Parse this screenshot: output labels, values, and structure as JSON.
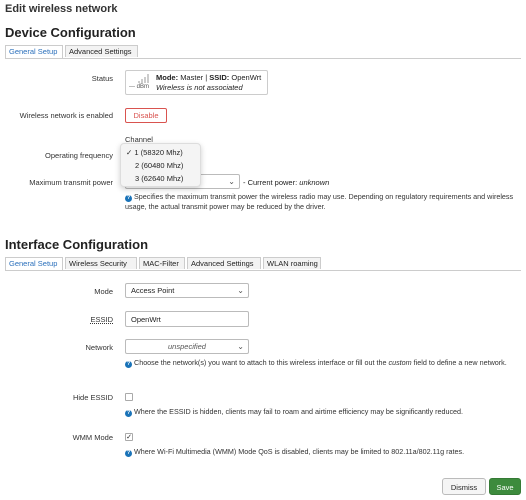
{
  "page_title": "Edit wireless network",
  "device": {
    "heading": "Device Configuration",
    "tabs": [
      "General Setup",
      "Advanced Settings"
    ],
    "status_label": "Status",
    "status": {
      "mode_prefix": "Mode:",
      "mode_value": "Master",
      "separator": "|",
      "ssid_prefix": "SSID:",
      "ssid_value": "OpenWrt",
      "signal": "--- dBm",
      "note": "Wireless is not associated"
    },
    "enabled_label": "Wireless network is enabled",
    "disable_button": "Disable",
    "channel_label": "Channel",
    "frequency_label": "Operating frequency",
    "frequency_options": [
      {
        "check": "✓",
        "label": "1 (58320 Mhz)"
      },
      {
        "check": "",
        "label": "2 (60480 Mhz)"
      },
      {
        "check": "",
        "label": "3 (62640 Mhz)"
      }
    ],
    "tx_label": "Maximum transmit power",
    "tx_current_prefix": "- Current power:",
    "tx_current_value": "unknown",
    "tx_help": "Specifies the maximum transmit power the wireless radio may use. Depending on regulatory requirements and wireless usage, the actual transmit power may be reduced by the driver."
  },
  "interface": {
    "heading": "Interface Configuration",
    "tabs": [
      "General Setup",
      "Wireless Security",
      "MAC-Filter",
      "Advanced Settings",
      "WLAN roaming"
    ],
    "mode_label": "Mode",
    "mode_value": "Access Point",
    "essid_label": "ESSID",
    "essid_value": "OpenWrt",
    "network_label": "Network",
    "network_value": "unspecified",
    "network_help_a": "Choose the network(s) you want to attach to this wireless interface or fill out the ",
    "network_help_em": "custom",
    "network_help_b": " field to define a new network.",
    "hide_label": "Hide ESSID",
    "hide_help": "Where the ESSID is hidden, clients may fail to roam and airtime efficiency may be significantly reduced.",
    "wmm_label": "WMM Mode",
    "wmm_check": "✓",
    "wmm_help": "Where Wi-Fi Multimedia (WMM) Mode QoS is disabled, clients may be limited to 802.11a/802.11g rates."
  },
  "footer": {
    "dismiss": "Dismiss",
    "save": "Save"
  },
  "colors": {
    "accent_blue": "#2a6fbb",
    "danger_red": "#d9534f",
    "save_green": "#3d8b3d"
  }
}
